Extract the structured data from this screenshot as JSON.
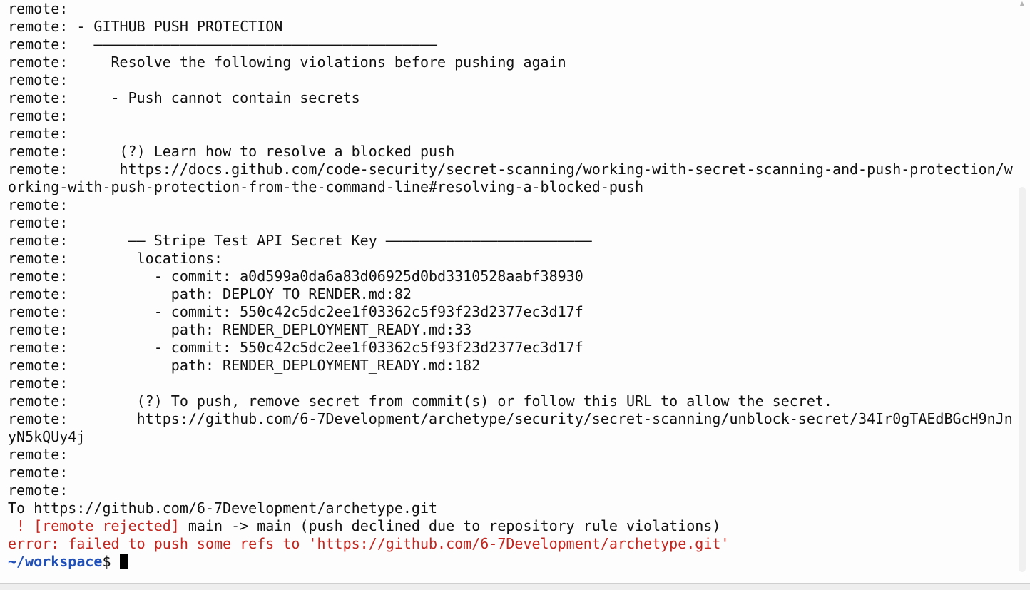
{
  "terminal": {
    "lines": [
      {
        "text": "remote:"
      },
      {
        "text": "remote: - GITHUB PUSH PROTECTION"
      },
      {
        "text": "remote:   ————————————————————————————————————————"
      },
      {
        "text": "remote:     Resolve the following violations before pushing again"
      },
      {
        "text": "remote:"
      },
      {
        "text": "remote:     - Push cannot contain secrets"
      },
      {
        "text": "remote:"
      },
      {
        "text": "remote:"
      },
      {
        "text": "remote:      (?) Learn how to resolve a blocked push"
      },
      {
        "text": "remote:      https://docs.github.com/code-security/secret-scanning/working-with-secret-scanning-and-push-protection/w"
      },
      {
        "text": "orking-with-push-protection-from-the-command-line#resolving-a-blocked-push"
      },
      {
        "text": "remote:"
      },
      {
        "text": "remote:"
      },
      {
        "text": "remote:       —— Stripe Test API Secret Key ————————————————————————"
      },
      {
        "text": "remote:        locations:"
      },
      {
        "text": "remote:          - commit: a0d599a0da6a83d06925d0bd3310528aabf38930"
      },
      {
        "text": "remote:            path: DEPLOY_TO_RENDER.md:82"
      },
      {
        "text": "remote:          - commit: 550c42c5dc2ee1f03362c5f93f23d2377ec3d17f"
      },
      {
        "text": "remote:            path: RENDER_DEPLOYMENT_READY.md:33"
      },
      {
        "text": "remote:          - commit: 550c42c5dc2ee1f03362c5f93f23d2377ec3d17f"
      },
      {
        "text": "remote:            path: RENDER_DEPLOYMENT_READY.md:182"
      },
      {
        "text": "remote:"
      },
      {
        "text": "remote:        (?) To push, remove secret from commit(s) or follow this URL to allow the secret."
      },
      {
        "text": "remote:        https://github.com/6-7Development/archetype/security/secret-scanning/unblock-secret/34Ir0gTAEdBGcH9nJn"
      },
      {
        "text": "yN5kQUy4j"
      },
      {
        "text": "remote:"
      },
      {
        "text": "remote:"
      },
      {
        "text": "remote:"
      },
      {
        "text": "To https://github.com/6-7Development/archetype.git"
      }
    ],
    "rejected_line": {
      "bang": " ! [remote rejected]",
      "rest": " main -> main (push declined due to repository rule violations)"
    },
    "error_line": "error: failed to push some refs to 'https://github.com/6-7Development/archetype.git'",
    "prompt": {
      "path": "~/workspace",
      "sigil": "$ "
    }
  },
  "colors": {
    "background": "#fdfdfd",
    "text": "#111111",
    "error": "#c3261f",
    "prompt_path": "#1f4fb8"
  }
}
